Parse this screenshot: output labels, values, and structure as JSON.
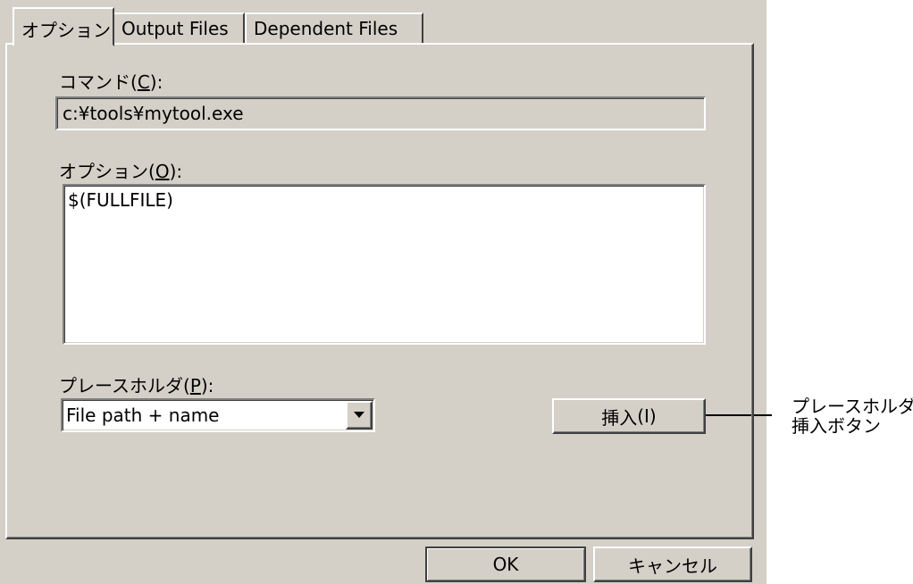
{
  "tabs": [
    {
      "label": "オプション",
      "active": true
    },
    {
      "label": "Output Files",
      "active": false
    },
    {
      "label": "Dependent Files",
      "active": false
    }
  ],
  "command": {
    "label": "コマンド(",
    "accesskey": "C",
    "label_suffix": "):",
    "value": "c:¥tools¥mytool.exe"
  },
  "options": {
    "label": "オプション(",
    "accesskey": "O",
    "label_suffix": "):",
    "value": "$(FULLFILE)"
  },
  "placeholder": {
    "label": "プレースホルダ(",
    "accesskey": "P",
    "label_suffix": "):",
    "selected": "File path + name",
    "dropdown_icon": "chevron-down-icon"
  },
  "insert_button": {
    "label": "挿入",
    "accesskey": "(I)"
  },
  "footer": {
    "ok_label": "OK",
    "cancel_label": "キャンセル"
  },
  "annotation": {
    "line1": "プレースホルダ",
    "line2": "挿入ボタン"
  }
}
